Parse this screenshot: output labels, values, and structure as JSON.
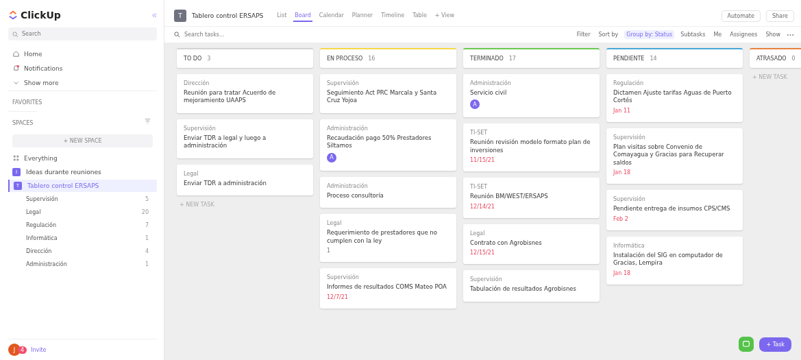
{
  "sidebar": {
    "logo": "ClickUp",
    "search": {
      "placeholder": "Search"
    },
    "nav": [
      {
        "label": "Home"
      },
      {
        "label": "Notifications"
      },
      {
        "label": "Show more"
      }
    ],
    "favorites": {
      "label": "FAVORITES"
    },
    "spaces": {
      "label": "SPACES",
      "new_space": "+ NEW SPACE",
      "everything": "Everything",
      "items": [
        {
          "label": "Ideas durante reuniones",
          "letter": "I",
          "selected": false
        },
        {
          "label": "Tablero control ERSAPS",
          "letter": "T",
          "selected": true,
          "children": [
            {
              "label": "Supervisión",
              "count": "5"
            },
            {
              "label": "Legal",
              "count": "20"
            },
            {
              "label": "Regulación",
              "count": "7"
            },
            {
              "label": "Informática",
              "count": "1"
            },
            {
              "label": "Dirección",
              "count": "4"
            },
            {
              "label": "Administración",
              "count": "1"
            }
          ]
        }
      ]
    },
    "user": {
      "initials": "J",
      "badge": "4",
      "invite": "Invite"
    }
  },
  "header": {
    "letter": "T",
    "title": "Tablero control ERSAPS",
    "views": [
      {
        "label": "List",
        "selected": false
      },
      {
        "label": "Board",
        "selected": true
      },
      {
        "label": "Calendar",
        "selected": false
      },
      {
        "label": "Planner",
        "selected": false
      },
      {
        "label": "Timeline",
        "selected": false
      },
      {
        "label": "Table",
        "selected": false
      }
    ],
    "add_view": "+ View",
    "automate": "Automate",
    "share": "Share"
  },
  "toolbar": {
    "search": {
      "placeholder": "Search tasks..."
    },
    "actions": [
      {
        "label": "Filter",
        "selected": false
      },
      {
        "label": "Sort by",
        "selected": false
      },
      {
        "label": "Group by: Status",
        "selected": true
      },
      {
        "label": "Subtasks",
        "selected": false
      },
      {
        "label": "Me",
        "selected": false
      },
      {
        "label": "Assignees",
        "selected": false
      },
      {
        "label": "Show",
        "selected": false
      }
    ]
  },
  "columns": [
    {
      "title": "TO DO",
      "count": "3",
      "color": "#d3d3d3",
      "new_task": "+ NEW TASK",
      "cards": [
        {
          "list": "Dirección",
          "title": "Reunión para tratar Acuerdo de mejoramiento UAAPS"
        },
        {
          "list": "Supervisión",
          "title": "Enviar TDR a legal y luego a administración"
        },
        {
          "list": "Legal",
          "title": "Enviar TDR a administración"
        }
      ]
    },
    {
      "title": "EN PROCESO",
      "count": "16",
      "color": "#f5d94a",
      "cards": [
        {
          "list": "Supervisión",
          "title": "Seguimiento Act PRC Marcala y Santa Cruz Yojoa"
        },
        {
          "list": "Administración",
          "title": "Recaudación pago 50% Prestadores Siltamos",
          "assignee": "A"
        },
        {
          "list": "Administración",
          "title": "Proceso consultoría"
        },
        {
          "list": "Legal",
          "title": "Requerimiento de prestadores que no cumplen con la ley",
          "subtasks": "1"
        },
        {
          "list": "Supervisión",
          "title": "Informes de resultados COMS Mateo POA",
          "due": "12/7/21"
        }
      ]
    },
    {
      "title": "TERMINADO",
      "count": "17",
      "color": "#6bc950",
      "cards": [
        {
          "list": "Administración",
          "title": "Servicio civil",
          "assignee": "A"
        },
        {
          "list": "TI-SET",
          "title": "Reunión revisión modelo formato plan de inversiones",
          "due": "11/15/21"
        },
        {
          "list": "TI-SET",
          "title": "Reunión BM/WEST/ERSAPS",
          "due": "12/14/21"
        },
        {
          "list": "Legal",
          "title": "Contrato con Agrobisnes",
          "due": "12/15/21"
        },
        {
          "list": "Supervisión",
          "title": "Tabulación de resultados Agrobisnes"
        }
      ]
    },
    {
      "title": "PENDIENTE",
      "count": "14",
      "color": "#49a7d6",
      "cards": [
        {
          "list": "Regulación",
          "title": "Dictamen Ajuste tarifas Aguas de Puerto Cortés",
          "due": "Jan 11"
        },
        {
          "list": "Supervisión",
          "title": "Plan visitas sobre Convenio de Comayagua y Gracias para Recuperar saldos",
          "due": "Jan 18"
        },
        {
          "list": "Supervisión",
          "title": "Pendiente entrega de insumos CPS/CMS",
          "due": "Feb 2"
        },
        {
          "list": "Informática",
          "title": "Instalación del SIG en computador de Gracias, Lempira",
          "due": "Jan 18"
        }
      ]
    },
    {
      "title": "ATRASADO",
      "count": "0",
      "color": "#e8823c",
      "new_task": "+ NEW TASK"
    }
  ],
  "fab": {
    "task": "+ Task"
  }
}
